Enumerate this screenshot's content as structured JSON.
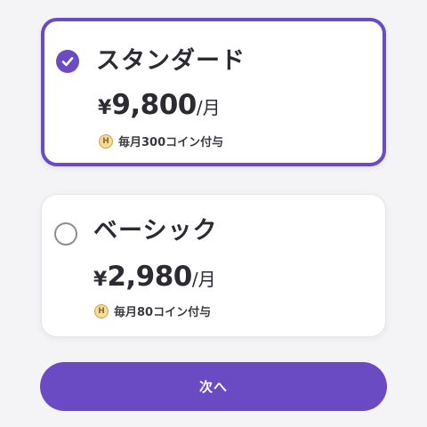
{
  "plans": [
    {
      "name": "スタンダード",
      "currency": "¥",
      "amount": "9,800",
      "unit": "/月",
      "coin_badge": "H",
      "coin_text": "毎月300コイン付与",
      "selected": true
    },
    {
      "name": "ベーシック",
      "currency": "¥",
      "amount": "2,980",
      "unit": "/月",
      "coin_badge": "H",
      "coin_text": "毎月80コイン付与",
      "selected": false
    }
  ],
  "next_button": {
    "label": "次へ"
  },
  "colors": {
    "accent": "#6a4bc4",
    "background": "#f4f4f6",
    "coin": "#f3dc98"
  },
  "icons": {
    "selected_radio": "check-circle-icon",
    "unselected_radio": "radio-empty-icon",
    "coin": "coin-icon"
  }
}
